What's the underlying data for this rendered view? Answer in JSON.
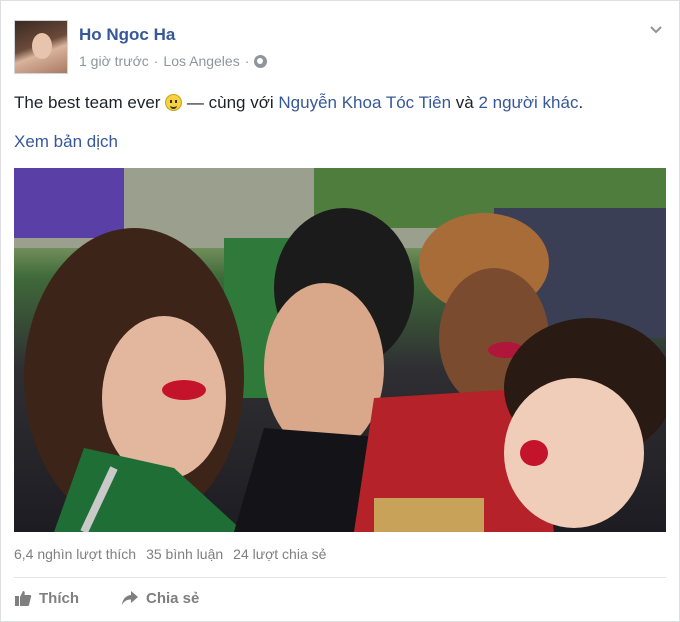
{
  "post": {
    "author": "Ho Ngoc Ha",
    "time": "1 giờ trước",
    "sep1": "·",
    "location": "Los Angeles",
    "sep2": "·",
    "text_before": "The best team ever",
    "text_mid": " — cùng với ",
    "tagged": "Nguyễn Khoa Tóc Tiên",
    "text_and": " và ",
    "others": "2 người khác",
    "text_end": ".",
    "translate": "Xem bản dịch",
    "icons": {
      "privacy": "globe-icon",
      "menu": "chevron-down-icon",
      "emoji": "smiley-icon"
    }
  },
  "stats": {
    "likes": "6,4 nghìn lượt thích",
    "comments": "35 bình luận",
    "shares": "24 lượt chia sẻ"
  },
  "actions": {
    "like": "Thích",
    "share": "Chia sẻ"
  },
  "colors": {
    "link": "#365899",
    "meta": "#90949c",
    "accent_lips": "#c4142b"
  }
}
